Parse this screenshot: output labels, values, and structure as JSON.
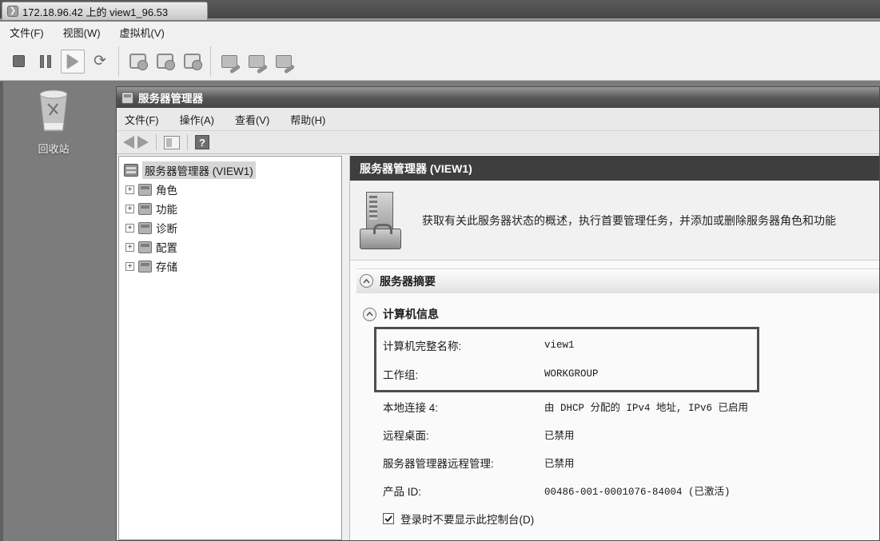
{
  "console": {
    "tab": {
      "title": "172.18.96.42 上的 view1_96.53"
    },
    "menu": {
      "items": [
        {
          "label": "文件(F)"
        },
        {
          "label": "视图(W)"
        },
        {
          "label": "虚拟机(V)"
        }
      ]
    },
    "toolbar_icons": [
      "power-off-icon",
      "suspend-icon",
      "power-on-icon",
      "reset-icon",
      "take-snapshot-icon",
      "revert-snapshot-icon",
      "manage-snapshots-icon",
      "edit-settings-icon",
      "install-tools-icon",
      "manage-devices-icon"
    ]
  },
  "desktop": {
    "recycle_bin_label": "回收站"
  },
  "server_manager": {
    "title": "服务器管理器",
    "menu": {
      "items": [
        {
          "label": "文件(F)"
        },
        {
          "label": "操作(A)"
        },
        {
          "label": "查看(V)"
        },
        {
          "label": "帮助(H)"
        }
      ]
    },
    "tree": {
      "root_label": "服务器管理器 (VIEW1)",
      "items": [
        {
          "label": "角色"
        },
        {
          "label": "功能"
        },
        {
          "label": "诊断"
        },
        {
          "label": "配置"
        },
        {
          "label": "存储"
        }
      ]
    },
    "content": {
      "header_title": "服务器管理器 (VIEW1)",
      "description": "获取有关此服务器状态的概述，执行首要管理任务，并添加或删除服务器角色和功能",
      "server_summary_title": "服务器摘要",
      "computer_info_title": "计算机信息",
      "info_rows": [
        {
          "label": "计算机完整名称:",
          "value": "view1"
        },
        {
          "label": "工作组:",
          "value": "WORKGROUP"
        },
        {
          "label": "本地连接 4:",
          "value": "由 DHCP 分配的 IPv4 地址, IPv6 已启用"
        },
        {
          "label": "远程桌面:",
          "value": "已禁用"
        },
        {
          "label": "服务器管理器远程管理:",
          "value": "已禁用"
        },
        {
          "label": "产品 ID:",
          "value": "00486-001-0001076-84004 (已激活)"
        }
      ],
      "console_checkbox": {
        "label": "登录时不要显示此控制台(D)",
        "checked": true
      }
    }
  },
  "colors": {
    "desktop": "#7c7c7c",
    "pane_header_band": "#3e3e3e",
    "highlight_border": "#4e4e4e"
  }
}
